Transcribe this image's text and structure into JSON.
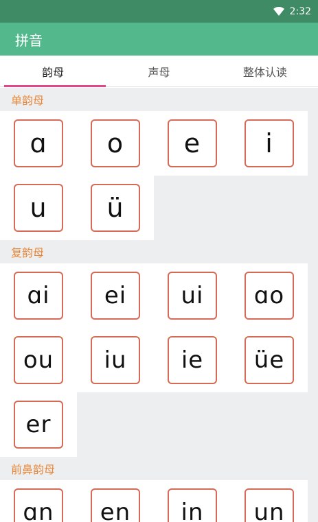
{
  "status": {
    "time": "2:32"
  },
  "app_bar": {
    "title": "拼音"
  },
  "tabs": [
    {
      "label": "韵母"
    },
    {
      "label": "声母"
    },
    {
      "label": "整体认读"
    }
  ],
  "sections": [
    {
      "title": "单韵母",
      "items": [
        "ɑ",
        "o",
        "e",
        "i",
        "u",
        "ü"
      ]
    },
    {
      "title": "复韵母",
      "items": [
        "ɑi",
        "ei",
        "ui",
        "ɑo",
        "ou",
        "iu",
        "ie",
        "üe",
        "er"
      ]
    },
    {
      "title": "前鼻韵母",
      "items": [
        "ɑn",
        "en",
        "in",
        "un"
      ]
    }
  ],
  "colors": {
    "status_bar": "#3f8b66",
    "app_bar": "#53b98c",
    "tab_indicator": "#e2468a",
    "section_title": "#e8873a",
    "card_border": "#d66a56"
  },
  "icons": {
    "wifi": "wifi-icon"
  }
}
